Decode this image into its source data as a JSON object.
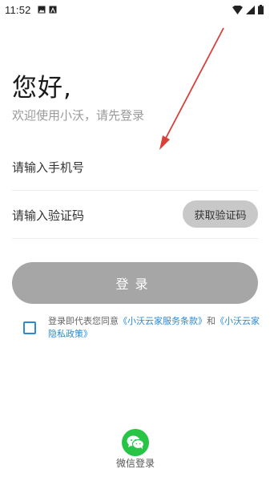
{
  "status_bar": {
    "time": "11:52",
    "left_icons": [
      "image-icon",
      "letter-a-icon"
    ],
    "right_icons": [
      "wifi-icon",
      "cellular-signal-icon",
      "battery-icon"
    ]
  },
  "header": {
    "greeting": "您好,",
    "subtitle": "欢迎使用小沃，请先登录"
  },
  "form": {
    "phone_placeholder": "请输入手机号",
    "code_placeholder": "请输入验证码",
    "get_code_label": "获取验证码",
    "login_label": "登录"
  },
  "agreement": {
    "checked": false,
    "prefix": "登录即代表您同意",
    "terms_link": "《小沃云家服务条款》",
    "conjunction": "和",
    "privacy_link": "《小沃云家隐私政策》"
  },
  "wechat": {
    "label": "微信登录",
    "icon": "wechat-icon"
  },
  "colors": {
    "accent_blue": "#2a8ad4",
    "wechat_green": "#28c445",
    "login_button": "#a6a6a6",
    "code_button": "#c8c8c8",
    "annotation_arrow": "#d9403a"
  }
}
